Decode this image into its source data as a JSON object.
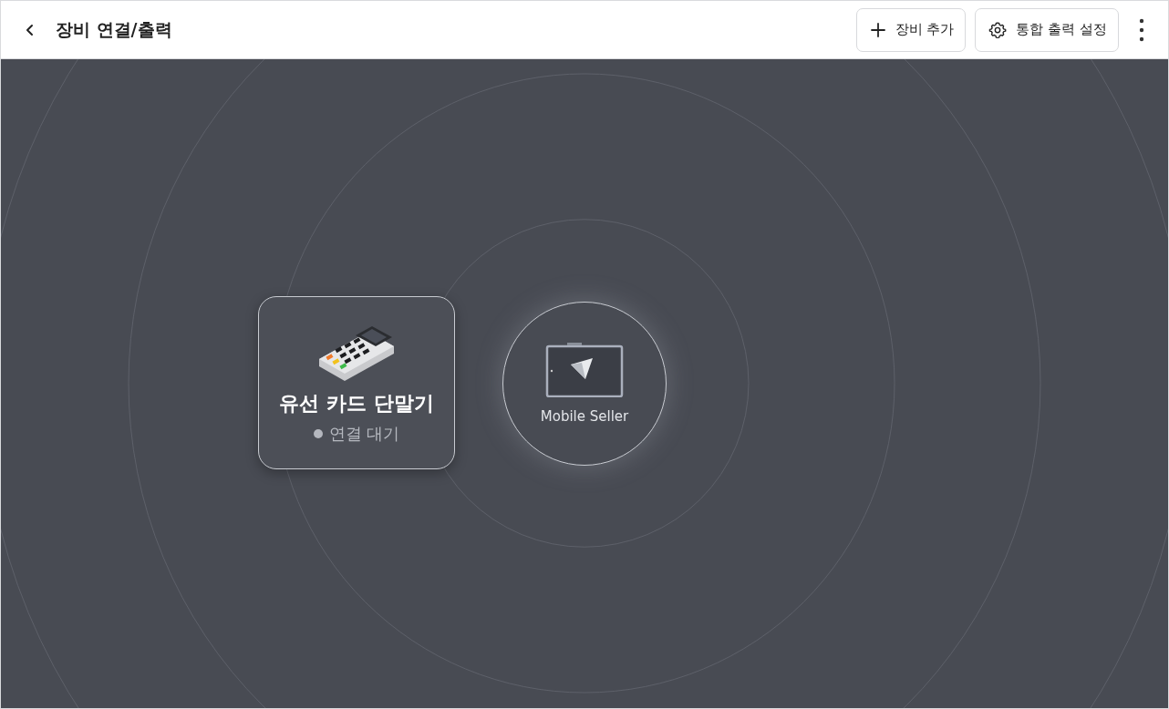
{
  "header": {
    "title": "장비 연결/출력",
    "buttons": [
      {
        "kind": "add",
        "label": "장비 추가"
      },
      {
        "kind": "settings",
        "label": "통합 출력 설정"
      }
    ]
  },
  "device": {
    "name": "유선 카드 단말기",
    "status": "연결 대기",
    "connected": false
  },
  "hub": {
    "label": "Mobile Seller"
  }
}
